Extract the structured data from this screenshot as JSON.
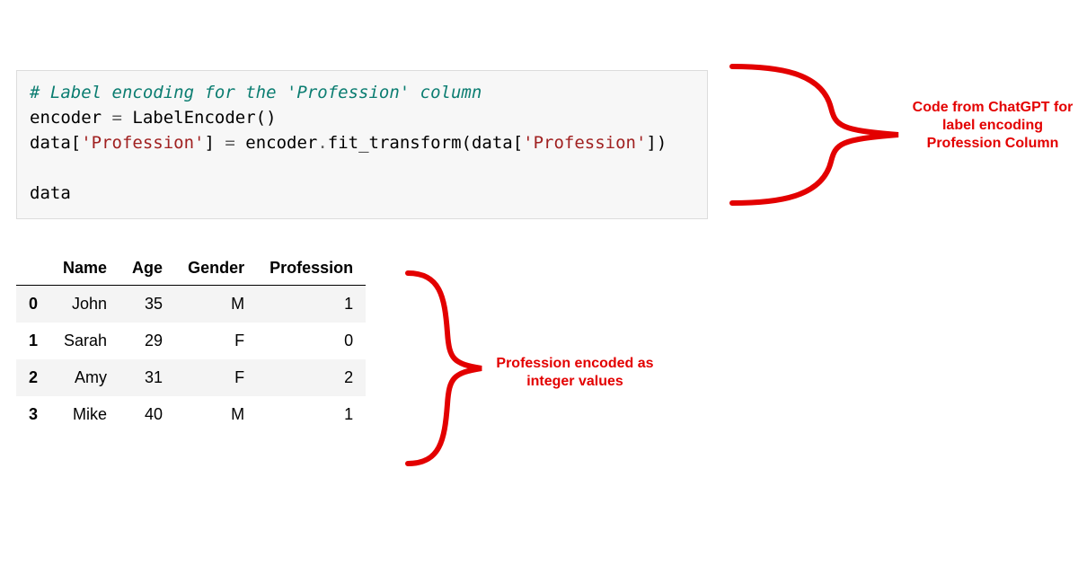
{
  "code": {
    "comment": "# Label encoding for the 'Profession' column",
    "line2_a": "encoder ",
    "line2_op1": "=",
    "line2_b": " LabelEncoder()",
    "line3_a": "data[",
    "line3_str1": "'Profession'",
    "line3_b": "] ",
    "line3_op1": "=",
    "line3_c": " encoder",
    "line3_dot": ".",
    "line3_d": "fit_transform(data[",
    "line3_str2": "'Profession'",
    "line3_e": "])",
    "line5": "data"
  },
  "chart_data": {
    "type": "table",
    "columns": [
      "Name",
      "Age",
      "Gender",
      "Profession"
    ],
    "index": [
      "0",
      "1",
      "2",
      "3"
    ],
    "rows": [
      {
        "Name": "John",
        "Age": "35",
        "Gender": "M",
        "Profession": "1"
      },
      {
        "Name": "Sarah",
        "Age": "29",
        "Gender": "F",
        "Profession": "0"
      },
      {
        "Name": "Amy",
        "Age": "31",
        "Gender": "F",
        "Profession": "2"
      },
      {
        "Name": "Mike",
        "Age": "40",
        "Gender": "M",
        "Profession": "1"
      }
    ]
  },
  "annotations": {
    "code_note": "Code from ChatGPT for label encoding Profession Column",
    "table_note": "Profession encoded as integer values"
  }
}
